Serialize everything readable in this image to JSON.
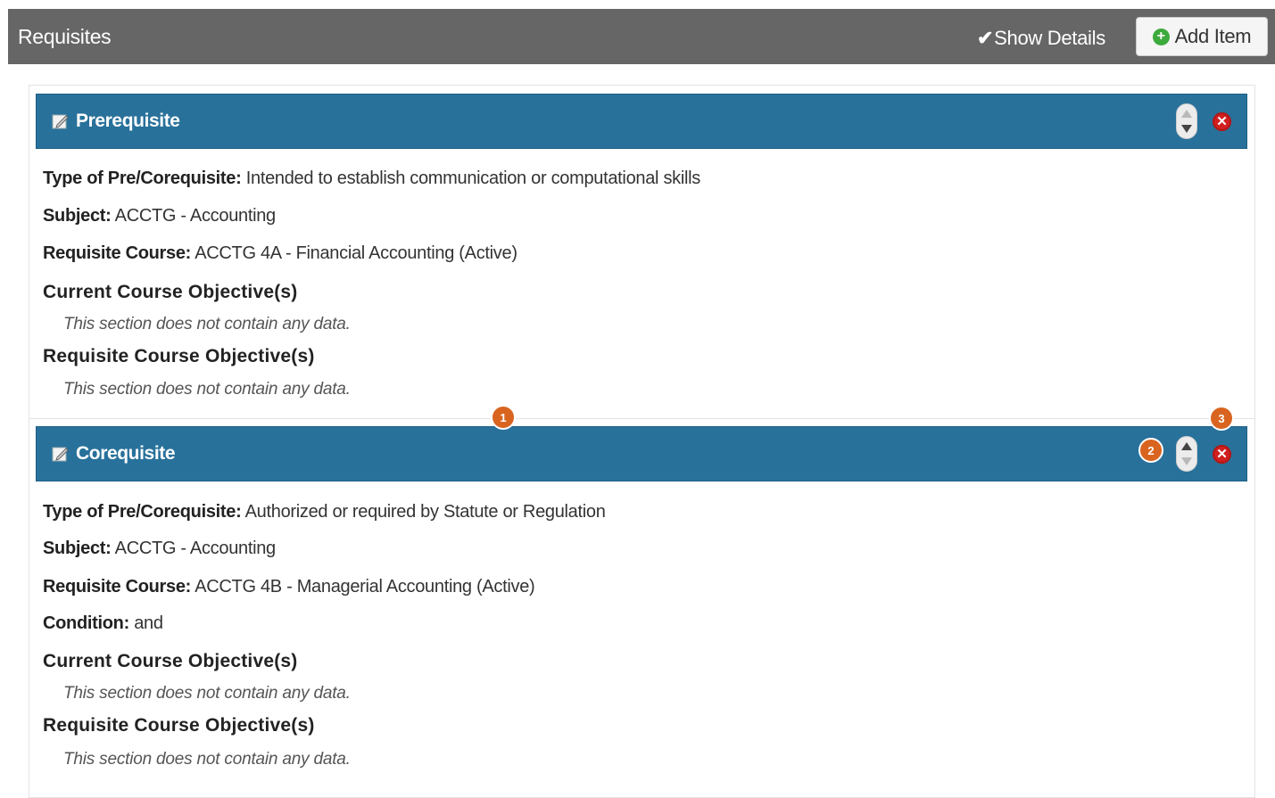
{
  "header": {
    "title": "Requisites",
    "show_details_label": "Show Details",
    "show_details_checked": true,
    "add_item_label": "Add Item"
  },
  "items": [
    {
      "title": "Prerequisite",
      "fields": [
        {
          "label": "Type of Pre/Corequisite:",
          "value": "Intended to establish communication or computational skills"
        },
        {
          "label": "Subject:",
          "value": "ACCTG - Accounting"
        },
        {
          "label": "Requisite Course:",
          "value": "ACCTG 4A - Financial Accounting (Active)"
        }
      ],
      "sections": [
        {
          "heading": "Current Course Objective(s)",
          "empty_text": "This section does not contain any data."
        },
        {
          "heading": "Requisite Course Objective(s)",
          "empty_text": "This section does not contain any data."
        }
      ]
    },
    {
      "title": "Corequisite",
      "fields": [
        {
          "label": "Type of Pre/Corequisite:",
          "value": "Authorized or required by Statute or Regulation"
        },
        {
          "label": "Subject:",
          "value": "ACCTG - Accounting"
        },
        {
          "label": "Requisite Course:",
          "value": "ACCTG 4B - Managerial Accounting (Active)"
        },
        {
          "label": "Condition:",
          "value": "and"
        }
      ],
      "sections": [
        {
          "heading": "Current Course Objective(s)",
          "empty_text": "This section does not contain any data."
        },
        {
          "heading": "Requisite Course Objective(s)",
          "empty_text": "This section does not contain any data."
        }
      ]
    }
  ],
  "markers": [
    "1",
    "2",
    "3"
  ],
  "colors": {
    "header_bg": "#666666",
    "item_bar_bg": "#28719b",
    "marker": "#d9641f",
    "delete": "#d11f1f",
    "add_icon": "#3caa3c"
  }
}
